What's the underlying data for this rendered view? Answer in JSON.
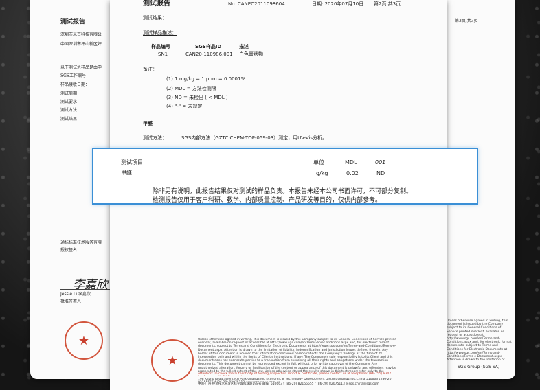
{
  "left_page": {
    "title": "测试报告",
    "lines": [
      "深圳市米古科技有限公",
      "中国深圳市坪山新区坪"
    ],
    "info_lines": [
      "以下测试之样品是由申",
      "SGS工作编号：",
      "样品接收日期：",
      "测试周期：",
      "测试要求：",
      "测试方法：",
      "测试结果："
    ],
    "footer_lines": [
      "通标标准技术服务有限",
      "授权签名"
    ],
    "signature": "李嘉欣",
    "signer": "Jessie Li 李嘉欣",
    "signer_role": "批准签署人"
  },
  "right_page": {
    "page_no": "第3页,共3页",
    "seal_footer": "SGS Group (SGS SA)"
  },
  "front_page": {
    "title": "测试报告",
    "report_no": "No. CANEC2011098604",
    "date": "日期: 2020年07月10日",
    "page_no": "第2页,共3页",
    "results_label": "测试结果：",
    "sample_desc_label": "测试样品描述：",
    "sample_table": {
      "headers": [
        "样品编号",
        "SGS样品ID",
        "描述"
      ],
      "row": [
        "SN1",
        "CAN20-110986.001",
        "白色膏状物"
      ]
    },
    "notes_label": "备注：",
    "notes": [
      "(1) 1 mg/kg = 1 ppm = 0.0001%",
      "(2) MDL = 方法检测限",
      "(3) ND = 未检出 ( < MDL )",
      "(4) \"-\" = 未规定"
    ],
    "section_title": "甲醛",
    "method_label": "测试方法：",
    "method_text": "SGS内部方法（GZTC CHEM-TOP-059-03）测定，用UV-Vis分析。",
    "fine_print": "Unless otherwise agreed in writing, this document is issued by the Company subject to its General Conditions of Service printed overleaf, available on request or accessible at http://www.sgs.com/en/Terms-and-Conditions.aspx and, for electronic format documents, subject to Terms and Conditions for Electronic Documents at http://www.sgs.com/en/Terms-and-Conditions/Terms-e-Document.aspx. Attention is drawn to the limitation of liability, indemnification and jurisdiction issues defined therein. Any holder of this document is advised that information contained hereon reflects the Company's findings at the time of its intervention only and within the limits of Client's instructions, if any. The Company's sole responsibility is to its Client and this document does not exonerate parties to a transaction from exercising all their rights and obligations under the transaction documents. This document cannot be reproduced except in full, without prior written approval of the Company. Any unauthorized alteration, forgery or falsification of the content or appearance of this document is unlawful and offenders may be prosecuted to the fullest extent of the law. Unless otherwise stated the results shown in this test report refer only to the sample(s) tested.",
    "attention": "Attention: To check the authenticity of testing /inspection report & certificate, please contact us at telephone: (86-755) 8307 1443, or email: CN.Doccheck@sgs.com",
    "address_en": "198 Kezhu Road,Scientech Park Guangzhou Economic & Technology Development District,Guangzhou,China 510663   t (86-20) 82155555   f (86-20) 82075113   www.sgsgroup.com.cn",
    "address_cn": "中国·广州·经济技术开发区科学城科珠路198号   邮编: 510663   t (86-20) 82155555   f (86-20) 82075113   e sgs.china@sgs.com"
  },
  "callout": {
    "headers": [
      "测试项目",
      "单位",
      "MDL",
      "001"
    ],
    "row": [
      "甲醛",
      "g/kg",
      "0.02",
      "ND"
    ],
    "note1": "除非另有说明，此报告结果仅对测试的样品负责。本报告未经本公司书面许可，不可部分复制。",
    "note2": "检测报告仅用于客户科研、教学、内部质量控制、产品研发等目的，仅供内部参考。"
  },
  "colors": {
    "accent_blue": "#3a8fd6",
    "seal_red": "#d2553d"
  }
}
